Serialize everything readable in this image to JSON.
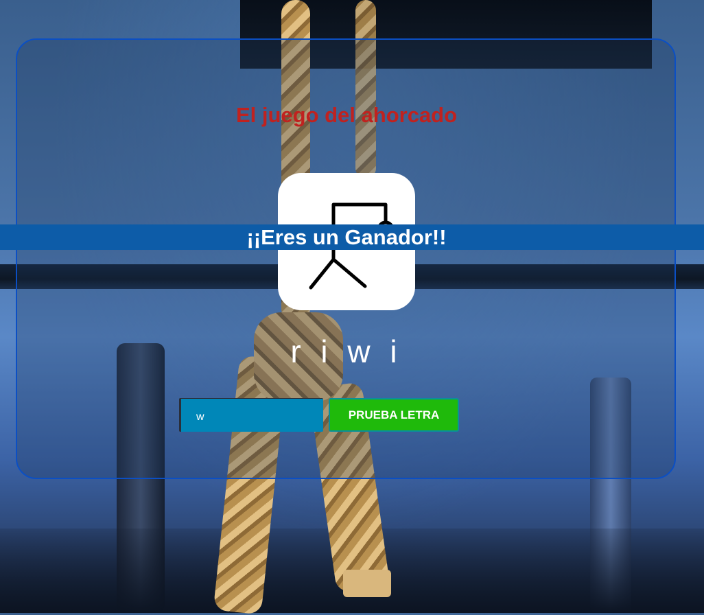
{
  "game": {
    "title": "El juego del ahorcado",
    "status_message": "¡¡Eres un Ganador!!",
    "word_display": "r i w i"
  },
  "controls": {
    "letter_value": "w",
    "try_button_label": "PRUEBA LETRA"
  },
  "colors": {
    "title": "#c0221f",
    "banner": "#0d5ca8",
    "input": "#0087b8",
    "button": "#1fba0b",
    "panel_border": "#0b4fc4"
  },
  "icons": {
    "hangman": "hangman-gallows-icon"
  }
}
